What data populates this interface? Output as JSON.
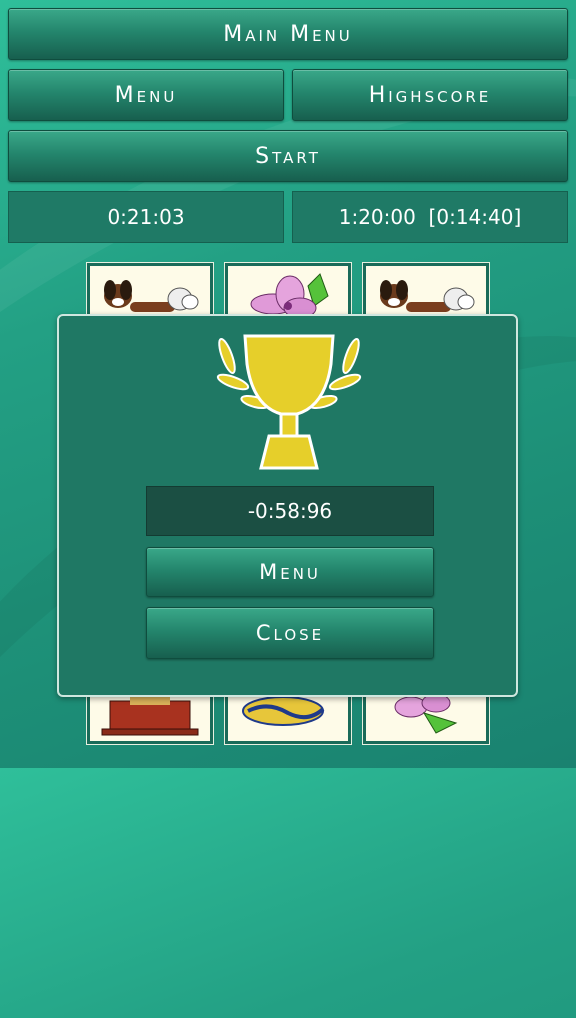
{
  "top": {
    "main_menu_label": "Main Menu",
    "menu_label": "Menu",
    "highscore_label": "Highscore",
    "start_label": "Start",
    "current_time": "0:21:03",
    "best_time": "1:20:00  [0:14:40]"
  },
  "board": {
    "cards_top": [
      "dog-card",
      "flower-card",
      "dog-card"
    ],
    "cards_bottom": [
      "clock-card",
      "fish-card",
      "flower-card"
    ]
  },
  "dialog": {
    "icon": "trophy-icon",
    "score": "-0:58:96",
    "menu_label": "Menu",
    "close_label": "Close"
  },
  "colors": {
    "background": "#23a084",
    "button": "#24866d",
    "dialog": "#1f7864",
    "trophy": "#e6cf2a"
  }
}
